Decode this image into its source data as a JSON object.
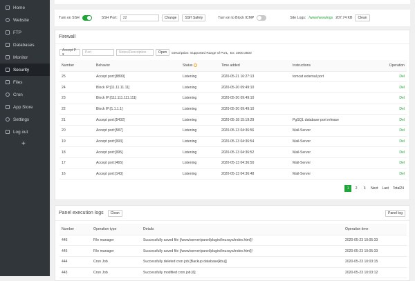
{
  "sidebar": {
    "items": [
      {
        "label": "Home",
        "icon": "home-icon"
      },
      {
        "label": "Website",
        "icon": "globe-icon"
      },
      {
        "label": "FTP",
        "icon": "ftp-icon"
      },
      {
        "label": "Databases",
        "icon": "database-icon"
      },
      {
        "label": "Monitor",
        "icon": "monitor-icon"
      },
      {
        "label": "Security",
        "icon": "shield-icon"
      },
      {
        "label": "Files",
        "icon": "folder-icon"
      },
      {
        "label": "Cron",
        "icon": "clock-icon"
      },
      {
        "label": "App Store",
        "icon": "grid-icon"
      },
      {
        "label": "Settings",
        "icon": "gear-icon"
      },
      {
        "label": "Log out",
        "icon": "logout-icon"
      }
    ],
    "add_symbol": "+"
  },
  "ssh": {
    "ssh_label": "Turn on SSH",
    "port_label": "SSH Port:",
    "port_value": "22",
    "change_btn": "Change",
    "safety_btn": "SSH Safety",
    "icmp_label": "Turn on to Block ICMP",
    "logs_label": "Site Logs:",
    "logs_path": "/www/wwwlogs",
    "logs_size": "207.74 KB",
    "clean_btn": "Clean"
  },
  "firewall": {
    "title": "Firewall",
    "select_value": "Accept P ▾",
    "port_placeholder": "Port",
    "note_placeholder": "Notes/Description",
    "open_btn": "Open",
    "description": "Description: Supported Range of Port。Ex: 3000:3500",
    "headers": [
      "Number",
      "Behavior",
      "Status",
      "Time added",
      "Instructions",
      "Operation"
    ],
    "rows": [
      {
        "num": "25",
        "behavior": "Accept port:[8899]",
        "status": "Listening",
        "time": "2020-05-21 16:27:13",
        "note": "tomcat external port",
        "op": "Del"
      },
      {
        "num": "24",
        "behavior": "Block IP:[11.11.11.11]",
        "status": "Listening",
        "time": "2020-05-20 09:49:10",
        "note": "",
        "op": "Del"
      },
      {
        "num": "23",
        "behavior": "Block IP:[111.111.111.111]",
        "status": "Listening",
        "time": "2020-05-20 09:49:10",
        "note": "",
        "op": "Del"
      },
      {
        "num": "22",
        "behavior": "Block IP:[1.1.1.1]",
        "status": "Listening",
        "time": "2020-05-20 09:49:10",
        "note": "",
        "op": "Del"
      },
      {
        "num": "21",
        "behavior": "Accept port:[5432]",
        "status": "Listening",
        "time": "2020-05-18 15:19:29",
        "note": "PgSQL database port release",
        "op": "Del"
      },
      {
        "num": "20",
        "behavior": "Accept port:[587]",
        "status": "Listening",
        "time": "2020-05-13 04:36:56",
        "note": "Mail-Server",
        "op": "Del"
      },
      {
        "num": "19",
        "behavior": "Accept port:[993]",
        "status": "Listening",
        "time": "2020-05-13 04:36:54",
        "note": "Mail-Server",
        "op": "Del"
      },
      {
        "num": "18",
        "behavior": "Accept port:[995]",
        "status": "Listening",
        "time": "2020-05-13 04:36:52",
        "note": "Mail-Server",
        "op": "Del"
      },
      {
        "num": "17",
        "behavior": "Accept port:[465]",
        "status": "Listening",
        "time": "2020-05-13 04:36:50",
        "note": "Mail-Server",
        "op": "Del"
      },
      {
        "num": "16",
        "behavior": "Accept port:[143]",
        "status": "Listening",
        "time": "2020-05-13 04:36:48",
        "note": "Mail-Server",
        "op": "Del"
      }
    ],
    "pager": {
      "pages": [
        "1",
        "2",
        "3"
      ],
      "next": "Next",
      "last": "Last",
      "total": "Total24"
    }
  },
  "logs": {
    "title": "Panel execution logs",
    "clean_btn": "Clean",
    "panel_log_btn": "Panel log",
    "headers": [
      "Number",
      "Operation type",
      "Details",
      "Operation time"
    ],
    "rows": [
      {
        "num": "446",
        "type": "File manager",
        "details": "Successfully saved file [/www/server/panel/plugin/linuxsys/index.html]!",
        "time": "2020-05-23 10:05:33"
      },
      {
        "num": "445",
        "type": "File manager",
        "details": "Successfully saved file [/www/server/panel/plugin/linuxsys/index.html]!",
        "time": "2020-05-23 10:05:33"
      },
      {
        "num": "444",
        "type": "Cron Job",
        "details": "Successfully deleted cron job [Backup database[kbu]]",
        "time": "2020-05-23 10:03:15"
      },
      {
        "num": "443",
        "type": "Cron Job",
        "details": "Successfully modified cron job [6]",
        "time": "2020-05-23 10:03:12"
      }
    ]
  },
  "colors": {
    "accent": "#20a53a",
    "sidebar": "#31363b",
    "sidebar_active": "#1f2226"
  }
}
